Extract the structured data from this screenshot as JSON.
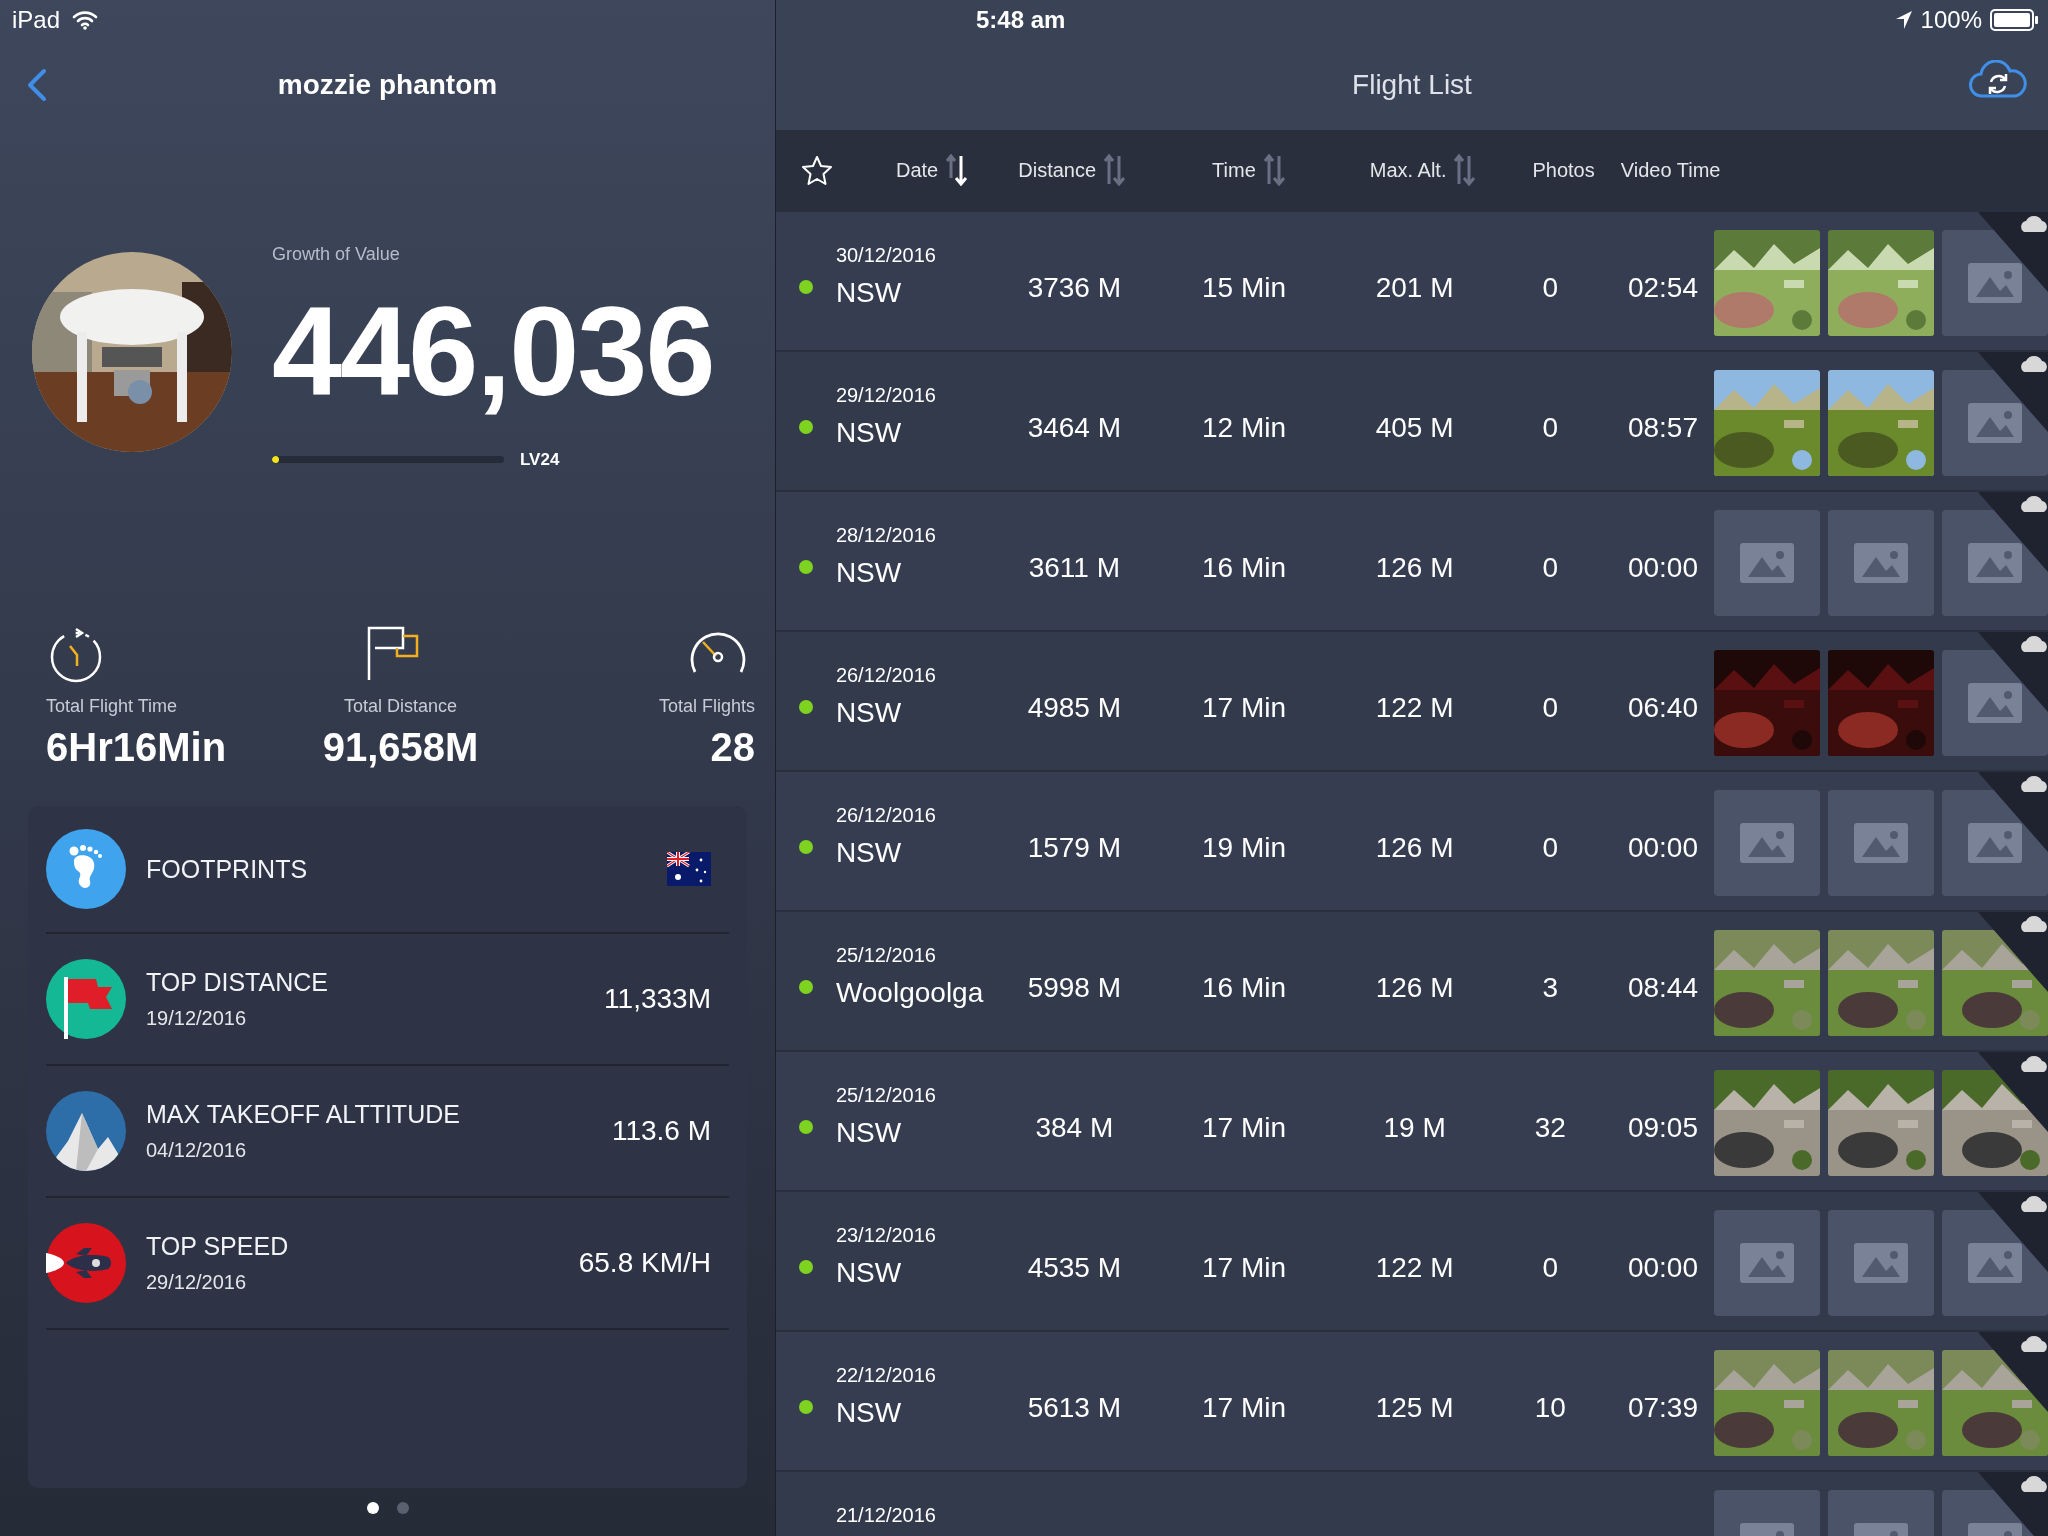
{
  "status_bar": {
    "device": "iPad",
    "time": "5:48 am",
    "battery": "100%"
  },
  "left_panel": {
    "title": "mozzie phantom",
    "growth_label": "Growth of Value",
    "growth_value": "446,036",
    "level": 0.03,
    "level_label": "LV24",
    "stats": [
      {
        "kind": "timer",
        "label": "Total Flight Time",
        "value": "6Hr16Min"
      },
      {
        "kind": "flag",
        "label": "Total Distance",
        "value": "91,658M"
      },
      {
        "kind": "gauge",
        "label": "Total Flights",
        "value": "28"
      }
    ],
    "records": [
      {
        "kind": "footprints",
        "title": "FOOTPRINTS"
      },
      {
        "kind": "flag",
        "title": "TOP DISTANCE",
        "date": "19/12/2016",
        "value": "11,333M"
      },
      {
        "kind": "mountain",
        "title": "MAX TAKEOFF ALTTITUDE",
        "date": "04/12/2016",
        "value": "113.6 M"
      },
      {
        "kind": "rocket",
        "title": "TOP SPEED",
        "date": "29/12/2016",
        "value": "65.8 KM/H"
      }
    ],
    "pages": [
      {
        "selected": true
      },
      {
        "selected": false
      }
    ]
  },
  "flight_list": {
    "title": "Flight List",
    "columns": [
      {
        "label": "Date",
        "kind": "sortable",
        "sorted": true
      },
      {
        "label": "Distance",
        "kind": "sortable",
        "sorted": false
      },
      {
        "label": "Time",
        "kind": "sortable",
        "sorted": false
      },
      {
        "label": "Max. Alt.",
        "kind": "sortable",
        "sorted": false
      },
      {
        "label": "Photos",
        "kind": "plain"
      },
      {
        "label": "Video Time",
        "kind": "plain"
      }
    ],
    "rows": [
      {
        "date": "30/12/2016",
        "location": "NSW",
        "distance": "3736 M",
        "time": "15 Min",
        "max_alt": "201 M",
        "photos": "0",
        "video_time": "02:54",
        "color": "#7ed321",
        "thumbs": [
          {
            "kind": "picture"
          },
          {
            "kind": "picture"
          },
          {
            "kind": "placeholder"
          }
        ]
      },
      {
        "date": "29/12/2016",
        "location": "NSW",
        "distance": "3464 M",
        "time": "12 Min",
        "max_alt": "405 M",
        "photos": "0",
        "video_time": "08:57",
        "color": "#7ed321",
        "thumbs": [
          {
            "kind": "picture"
          },
          {
            "kind": "picture"
          },
          {
            "kind": "placeholder"
          }
        ]
      },
      {
        "date": "28/12/2016",
        "location": "NSW",
        "distance": "3611 M",
        "time": "16 Min",
        "max_alt": "126 M",
        "photos": "0",
        "video_time": "00:00",
        "color": "#7ed321",
        "thumbs": [
          {
            "kind": "placeholder"
          },
          {
            "kind": "placeholder"
          },
          {
            "kind": "placeholder"
          }
        ]
      },
      {
        "date": "26/12/2016",
        "location": "NSW",
        "distance": "4985 M",
        "time": "17 Min",
        "max_alt": "122 M",
        "photos": "0",
        "video_time": "06:40",
        "color": "#7ed321",
        "thumbs": [
          {
            "kind": "picture"
          },
          {
            "kind": "picture"
          },
          {
            "kind": "placeholder"
          }
        ]
      },
      {
        "date": "26/12/2016",
        "location": "NSW",
        "distance": "1579 M",
        "time": "19 Min",
        "max_alt": "126 M",
        "photos": "0",
        "video_time": "00:00",
        "color": "#7ed321",
        "thumbs": [
          {
            "kind": "placeholder"
          },
          {
            "kind": "placeholder"
          },
          {
            "kind": "placeholder"
          }
        ]
      },
      {
        "date": "25/12/2016",
        "location": "Woolgoolga",
        "distance": "5998 M",
        "time": "16 Min",
        "max_alt": "126 M",
        "photos": "3",
        "video_time": "08:44",
        "color": "#7ed321",
        "thumbs": [
          {
            "kind": "picture"
          },
          {
            "kind": "picture"
          },
          {
            "kind": "picture"
          }
        ]
      },
      {
        "date": "25/12/2016",
        "location": "NSW",
        "distance": "384 M",
        "time": "17 Min",
        "max_alt": "19 M",
        "photos": "32",
        "video_time": "09:05",
        "color": "#7ed321",
        "thumbs": [
          {
            "kind": "picture"
          },
          {
            "kind": "picture"
          },
          {
            "kind": "picture"
          }
        ]
      },
      {
        "date": "23/12/2016",
        "location": "NSW",
        "distance": "4535 M",
        "time": "17 Min",
        "max_alt": "122 M",
        "photos": "0",
        "video_time": "00:00",
        "color": "#7ed321",
        "thumbs": [
          {
            "kind": "placeholder"
          },
          {
            "kind": "placeholder"
          },
          {
            "kind": "placeholder"
          }
        ]
      },
      {
        "date": "22/12/2016",
        "location": "NSW",
        "distance": "5613 M",
        "time": "17 Min",
        "max_alt": "125 M",
        "photos": "10",
        "video_time": "07:39",
        "color": "#7ed321",
        "thumbs": [
          {
            "kind": "picture"
          },
          {
            "kind": "picture"
          },
          {
            "kind": "picture"
          }
        ]
      },
      {
        "date": "21/12/2016",
        "thumbs": [
          {
            "kind": "placeholder"
          },
          {
            "kind": "placeholder"
          },
          {
            "kind": "placeholder"
          }
        ]
      }
    ]
  }
}
